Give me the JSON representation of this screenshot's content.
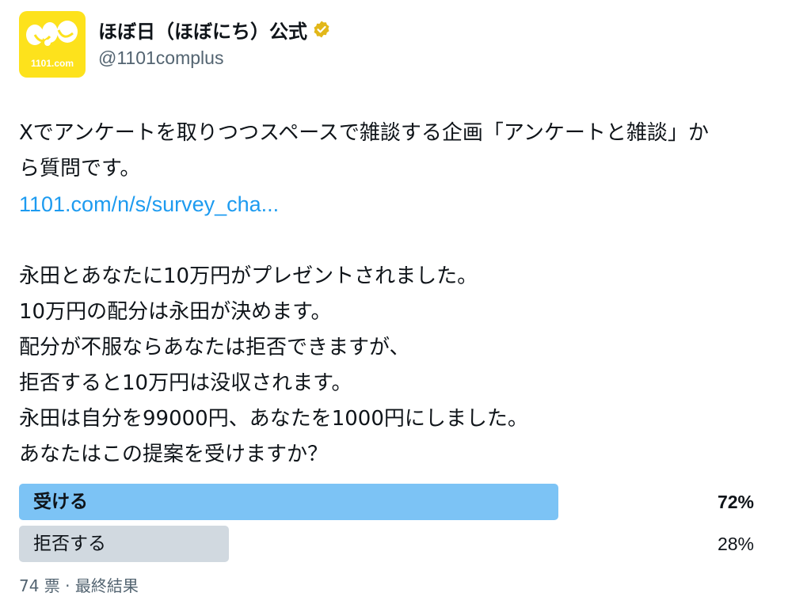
{
  "account": {
    "logo_text": "1101.com",
    "display_name": "ほぼ日（ほぼにち）公式",
    "verified_icon": "verified-badge-gold",
    "handle": "@1101complus"
  },
  "post": {
    "lines": [
      "Xでアンケートを取りつつスペースで雑談する企画「アンケートと雑談」か",
      "ら質問です。"
    ],
    "link": "1101.com/n/s/survey_cha...",
    "question_lines": [
      "永田とあなたに10万円がプレゼントされました。",
      "10万円の配分は永田が決めます。",
      "配分が不服ならあなたは拒否できますが、",
      "拒否すると10万円は没収されます。",
      "永田は自分を99000円、あなたを1000円にしました。",
      "あなたはこの提案を受けますか？"
    ]
  },
  "poll": {
    "options": [
      {
        "label": "受ける",
        "percent": "72%",
        "value": 72,
        "winner": true
      },
      {
        "label": "拒否する",
        "percent": "28%",
        "value": 28,
        "winner": false
      }
    ],
    "votes": "74 票",
    "separator": " · ",
    "status": "最終結果"
  },
  "colors": {
    "link": "#1d9bf0",
    "winner_bar": "#7cc3f5",
    "other_bar": "#d1d9e0",
    "logo_bg": "#fde21c",
    "verified": "#e2b719"
  }
}
